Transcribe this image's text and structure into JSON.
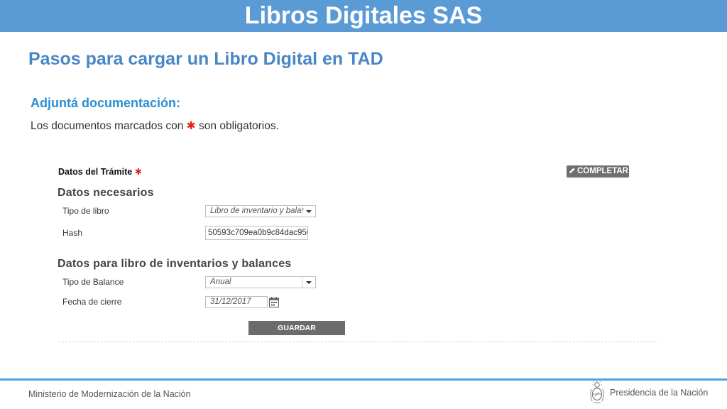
{
  "slide": {
    "title": "Libros Digitales SAS",
    "subtitle": "Pasos para cargar un Libro Digital en TAD"
  },
  "form": {
    "heading": "Adjuntá documentación:",
    "note_before": "Los documentos marcados con",
    "note_after": "son obligatorios.",
    "required_symbol": "✱",
    "tramite_title": "Datos del Trámite",
    "completar_label": "COMPLETAR",
    "group1_heading": "Datos necesarios",
    "tipo_libro_label": "Tipo de libro",
    "tipo_libro_value": "Libro de inventario y balan",
    "hash_label": "Hash",
    "hash_value": "50593c709ea0b9c84dac950",
    "group2_heading": "Datos para libro de inventarios y balances",
    "tipo_balance_label": "Tipo de Balance",
    "tipo_balance_value": "Anual",
    "fecha_cierre_label": "Fecha de cierre",
    "fecha_cierre_value": "31/12/2017",
    "guardar_label": "GUARDAR"
  },
  "footer": {
    "left": "Ministerio de Modernización de la Nación",
    "right": "Presidencia de la Nación"
  },
  "colors": {
    "title_bar": "#5b9bd5",
    "accent_blue": "#2b8fcf",
    "required_red": "#e0201c",
    "button_gray": "#6b6b6b"
  },
  "icons": {
    "completar": "pencil-icon",
    "fecha": "calendar-icon",
    "footer": "coat-of-arms-icon"
  }
}
